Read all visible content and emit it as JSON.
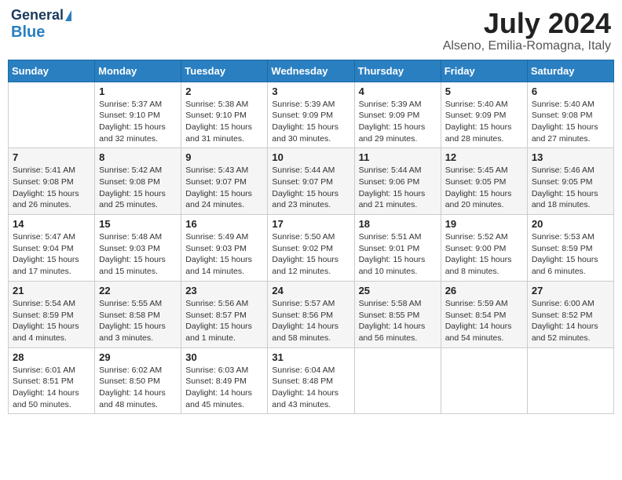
{
  "logo": {
    "line1": "General",
    "line2": "Blue"
  },
  "title": "July 2024",
  "subtitle": "Alseno, Emilia-Romagna, Italy",
  "headers": [
    "Sunday",
    "Monday",
    "Tuesday",
    "Wednesday",
    "Thursday",
    "Friday",
    "Saturday"
  ],
  "weeks": [
    [
      {
        "day": "",
        "info": ""
      },
      {
        "day": "1",
        "info": "Sunrise: 5:37 AM\nSunset: 9:10 PM\nDaylight: 15 hours\nand 32 minutes."
      },
      {
        "day": "2",
        "info": "Sunrise: 5:38 AM\nSunset: 9:10 PM\nDaylight: 15 hours\nand 31 minutes."
      },
      {
        "day": "3",
        "info": "Sunrise: 5:39 AM\nSunset: 9:09 PM\nDaylight: 15 hours\nand 30 minutes."
      },
      {
        "day": "4",
        "info": "Sunrise: 5:39 AM\nSunset: 9:09 PM\nDaylight: 15 hours\nand 29 minutes."
      },
      {
        "day": "5",
        "info": "Sunrise: 5:40 AM\nSunset: 9:09 PM\nDaylight: 15 hours\nand 28 minutes."
      },
      {
        "day": "6",
        "info": "Sunrise: 5:40 AM\nSunset: 9:08 PM\nDaylight: 15 hours\nand 27 minutes."
      }
    ],
    [
      {
        "day": "7",
        "info": "Sunrise: 5:41 AM\nSunset: 9:08 PM\nDaylight: 15 hours\nand 26 minutes."
      },
      {
        "day": "8",
        "info": "Sunrise: 5:42 AM\nSunset: 9:08 PM\nDaylight: 15 hours\nand 25 minutes."
      },
      {
        "day": "9",
        "info": "Sunrise: 5:43 AM\nSunset: 9:07 PM\nDaylight: 15 hours\nand 24 minutes."
      },
      {
        "day": "10",
        "info": "Sunrise: 5:44 AM\nSunset: 9:07 PM\nDaylight: 15 hours\nand 23 minutes."
      },
      {
        "day": "11",
        "info": "Sunrise: 5:44 AM\nSunset: 9:06 PM\nDaylight: 15 hours\nand 21 minutes."
      },
      {
        "day": "12",
        "info": "Sunrise: 5:45 AM\nSunset: 9:05 PM\nDaylight: 15 hours\nand 20 minutes."
      },
      {
        "day": "13",
        "info": "Sunrise: 5:46 AM\nSunset: 9:05 PM\nDaylight: 15 hours\nand 18 minutes."
      }
    ],
    [
      {
        "day": "14",
        "info": "Sunrise: 5:47 AM\nSunset: 9:04 PM\nDaylight: 15 hours\nand 17 minutes."
      },
      {
        "day": "15",
        "info": "Sunrise: 5:48 AM\nSunset: 9:03 PM\nDaylight: 15 hours\nand 15 minutes."
      },
      {
        "day": "16",
        "info": "Sunrise: 5:49 AM\nSunset: 9:03 PM\nDaylight: 15 hours\nand 14 minutes."
      },
      {
        "day": "17",
        "info": "Sunrise: 5:50 AM\nSunset: 9:02 PM\nDaylight: 15 hours\nand 12 minutes."
      },
      {
        "day": "18",
        "info": "Sunrise: 5:51 AM\nSunset: 9:01 PM\nDaylight: 15 hours\nand 10 minutes."
      },
      {
        "day": "19",
        "info": "Sunrise: 5:52 AM\nSunset: 9:00 PM\nDaylight: 15 hours\nand 8 minutes."
      },
      {
        "day": "20",
        "info": "Sunrise: 5:53 AM\nSunset: 8:59 PM\nDaylight: 15 hours\nand 6 minutes."
      }
    ],
    [
      {
        "day": "21",
        "info": "Sunrise: 5:54 AM\nSunset: 8:59 PM\nDaylight: 15 hours\nand 4 minutes."
      },
      {
        "day": "22",
        "info": "Sunrise: 5:55 AM\nSunset: 8:58 PM\nDaylight: 15 hours\nand 3 minutes."
      },
      {
        "day": "23",
        "info": "Sunrise: 5:56 AM\nSunset: 8:57 PM\nDaylight: 15 hours\nand 1 minute."
      },
      {
        "day": "24",
        "info": "Sunrise: 5:57 AM\nSunset: 8:56 PM\nDaylight: 14 hours\nand 58 minutes."
      },
      {
        "day": "25",
        "info": "Sunrise: 5:58 AM\nSunset: 8:55 PM\nDaylight: 14 hours\nand 56 minutes."
      },
      {
        "day": "26",
        "info": "Sunrise: 5:59 AM\nSunset: 8:54 PM\nDaylight: 14 hours\nand 54 minutes."
      },
      {
        "day": "27",
        "info": "Sunrise: 6:00 AM\nSunset: 8:52 PM\nDaylight: 14 hours\nand 52 minutes."
      }
    ],
    [
      {
        "day": "28",
        "info": "Sunrise: 6:01 AM\nSunset: 8:51 PM\nDaylight: 14 hours\nand 50 minutes."
      },
      {
        "day": "29",
        "info": "Sunrise: 6:02 AM\nSunset: 8:50 PM\nDaylight: 14 hours\nand 48 minutes."
      },
      {
        "day": "30",
        "info": "Sunrise: 6:03 AM\nSunset: 8:49 PM\nDaylight: 14 hours\nand 45 minutes."
      },
      {
        "day": "31",
        "info": "Sunrise: 6:04 AM\nSunset: 8:48 PM\nDaylight: 14 hours\nand 43 minutes."
      },
      {
        "day": "",
        "info": ""
      },
      {
        "day": "",
        "info": ""
      },
      {
        "day": "",
        "info": ""
      }
    ]
  ]
}
